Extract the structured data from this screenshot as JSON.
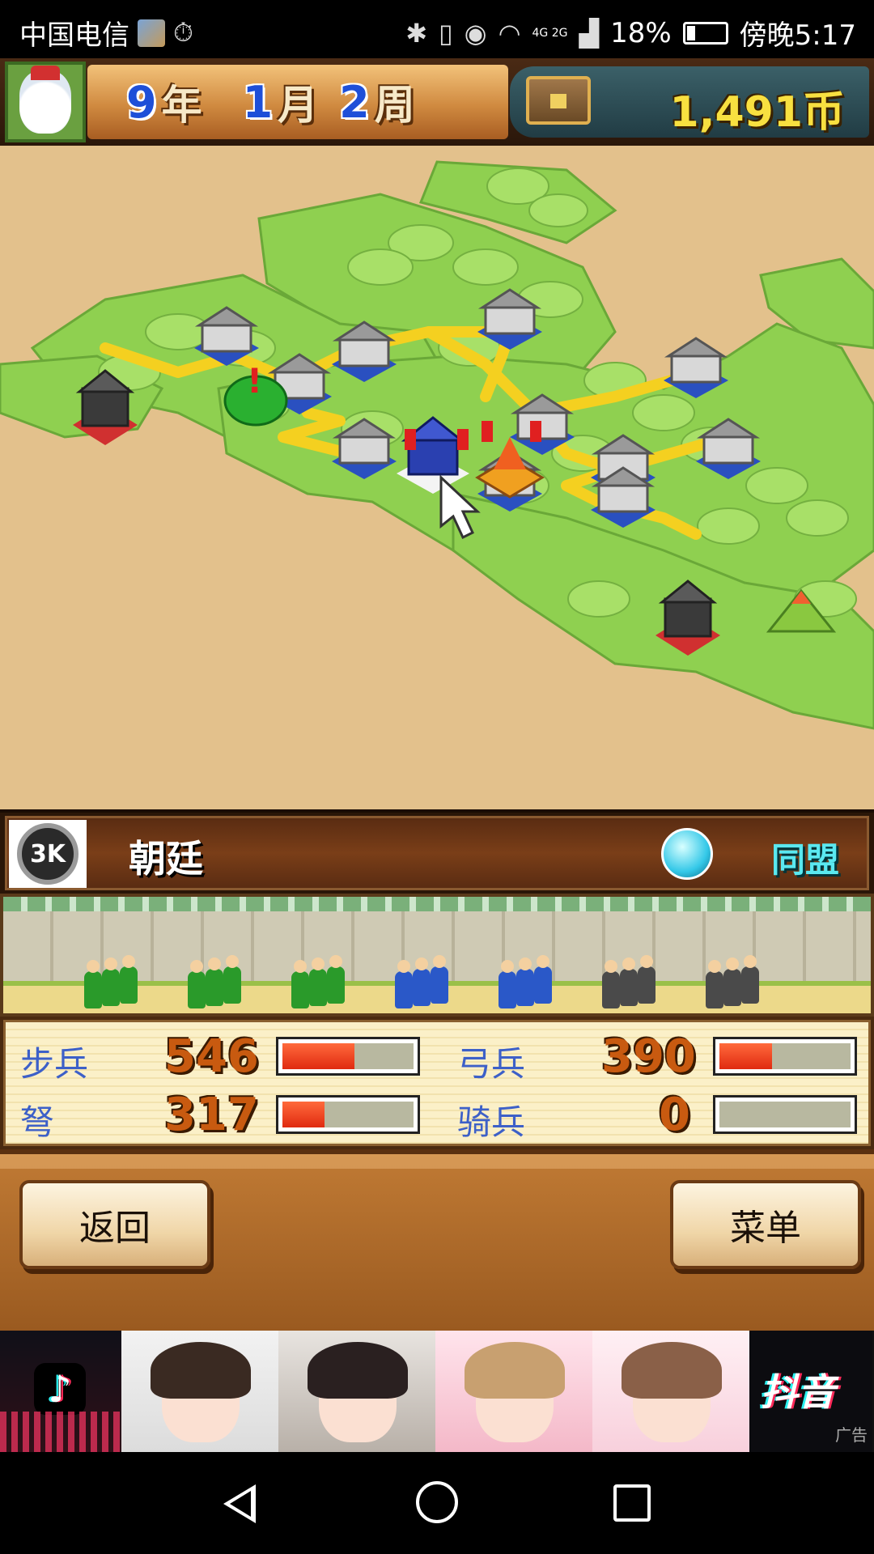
{
  "status_bar": {
    "carrier": "中国电信",
    "battery_percent": "18%",
    "time": "傍晚5:17",
    "network_label": "4G 2G",
    "icons": [
      "app-thumbnail-icon",
      "stopwatch-icon",
      "bluetooth-icon",
      "vibrate-icon",
      "eye-icon",
      "wifi-icon",
      "signal-icon",
      "battery-icon"
    ]
  },
  "header": {
    "year_num": "9",
    "year_unit": "年",
    "month_num": "1",
    "month_unit": "月",
    "week_num": "2",
    "week_unit": "周",
    "money": "1,491币"
  },
  "map": {
    "alert_mark": "!",
    "colors": {
      "sand": "#e3c18c",
      "grass": "#8fd050",
      "road": "#f4d020",
      "player": "#2a50c0",
      "neutral": "#c0c0c0"
    }
  },
  "faction": {
    "emblem_text": "3K",
    "name": "朝廷",
    "relation": "同盟"
  },
  "troops": {
    "infantry_label": "步兵",
    "infantry_value": "546",
    "infantry_ratio": 0.55,
    "archer_label": "弓兵",
    "archer_value": "390",
    "archer_ratio": 0.4,
    "crossbow_label": "弩",
    "crossbow_value": "317",
    "crossbow_ratio": 0.32,
    "cavalry_label": "骑兵",
    "cavalry_value": "0",
    "cavalry_ratio": 0
  },
  "buttons": {
    "back": "返回",
    "menu": "菜单"
  },
  "ad": {
    "brand": "抖音",
    "tag": "广告"
  }
}
